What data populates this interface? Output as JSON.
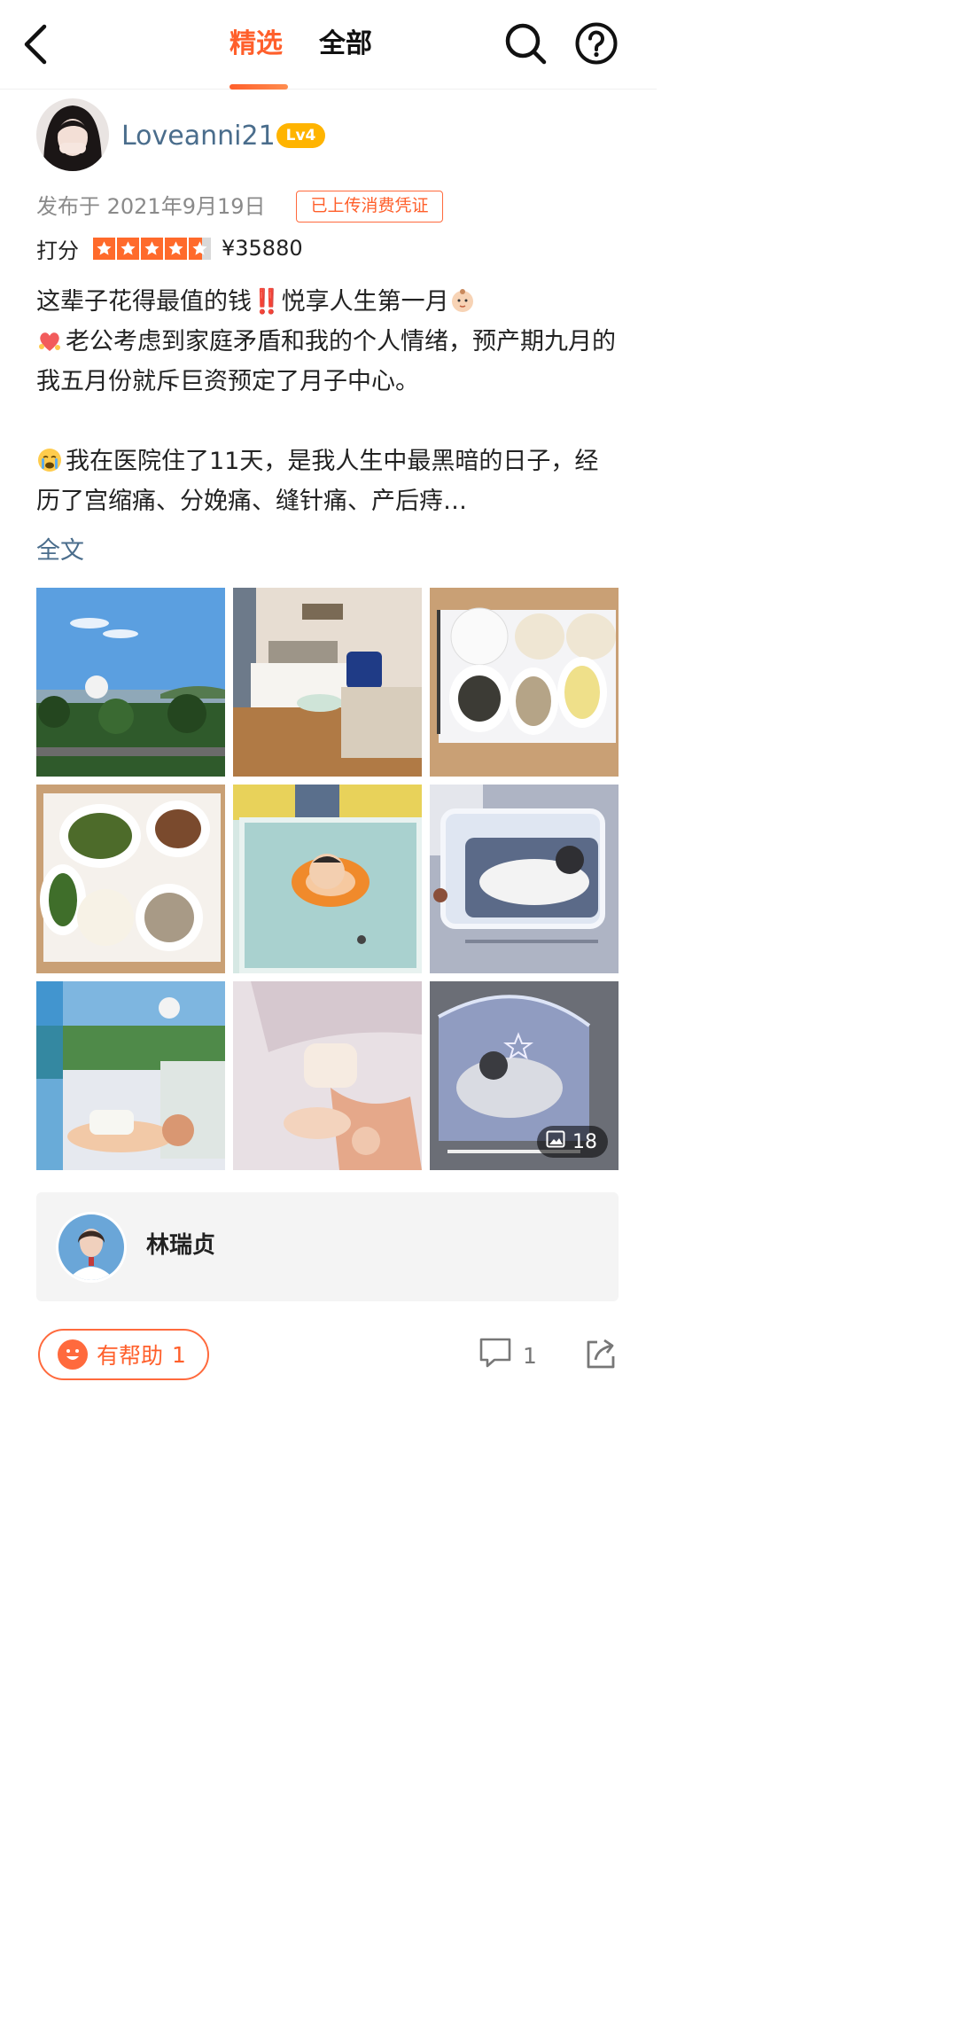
{
  "nav": {
    "tab_featured": "精选",
    "tab_all": "全部"
  },
  "author": {
    "username": "Loveanni21",
    "level": "Lv4"
  },
  "meta": {
    "published": "发布于 2021年9月19日",
    "receipt_badge": "已上传消费凭证",
    "rating_label": "打分",
    "rating": 4.5,
    "price": "¥35880"
  },
  "post": {
    "line1": "这辈子花得最值的钱‼️悦享人生第一月",
    "para1": "老公考虑到家庭矛盾和我的个人情绪，预产期九月的我五月份就斥巨资预定了月子中心。",
    "para2": "我在医院住了11天，是我人生中最黑暗的日子，经历了宫缩痛、分娩痛、缝针痛、产后痔…",
    "full_text_link": "全文"
  },
  "photos": {
    "count": "18",
    "items": [
      "coast-view-photo",
      "bedroom-photo",
      "meal-photo-1",
      "meal-photo-2",
      "baby-swim-photo",
      "baby-crib-photo",
      "baby-window-photo",
      "baby-hand-photo",
      "baby-netted-crib-photo"
    ]
  },
  "doctor": {
    "name": "林瑞贞"
  },
  "actions": {
    "helpful_label": "有帮助",
    "helpful_count": "1",
    "comment_count": "1"
  },
  "colors": {
    "accent": "#ff5f2b",
    "link": "#4a6d8c",
    "level_badge": "#ffb400"
  }
}
